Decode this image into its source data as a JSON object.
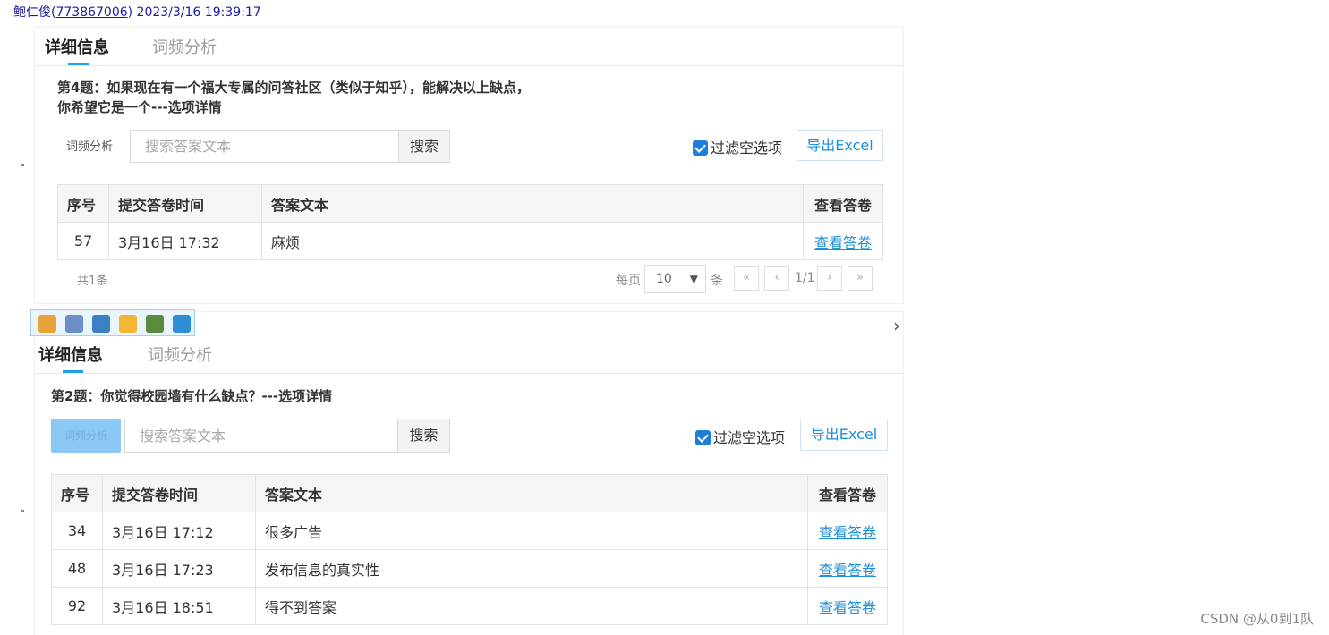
{
  "header": {
    "name": "鲍仁俊(",
    "qq": "773867006",
    "rest": ") 2023/3/16 19:39:17"
  },
  "panel1": {
    "tabs": [
      {
        "label": "详细信息"
      },
      {
        "label": "词频分析"
      }
    ],
    "title_line1": "第4题：如果现在有一个福大专属的问答社区（类似于知乎），能解决以上缺点，",
    "title_line2": "你希望它是一个---选项详情",
    "wordfreq_label": "词频分析",
    "search_placeholder": "搜索答案文本",
    "search_button": "搜索",
    "filter_label": "过滤空选项",
    "export_label": "导出Excel",
    "columns": [
      "序号",
      "提交答卷时间",
      "答案文本",
      "查看答卷"
    ],
    "rows": [
      {
        "num": "57",
        "time": "3月16日 17:32",
        "text": "麻烦",
        "link": "查看答卷"
      }
    ],
    "total": "共1条",
    "per_page_label": "每页",
    "per_page_value": "10",
    "per_page_unit": "条",
    "pager": {
      "first": "«",
      "prev": "‹",
      "page": "1/1",
      "next": "›",
      "last": "»"
    }
  },
  "toolbar": {
    "icons": [
      {
        "name": "add-icon",
        "color": "#e8a23a"
      },
      {
        "name": "save-icon",
        "color": "#6b8fc7"
      },
      {
        "name": "monitor-icon",
        "color": "#3b7fc4"
      },
      {
        "name": "emoji-icon",
        "color": "#f2b632"
      },
      {
        "name": "image-icon",
        "color": "#5a8a3c"
      },
      {
        "name": "star-icon",
        "color": "#2f8fd6"
      }
    ]
  },
  "panel2": {
    "tabs": [
      {
        "label": "详细信息"
      },
      {
        "label": "词频分析"
      }
    ],
    "title_line1": "第2题：你觉得校园墙有什么缺点？---选项详情",
    "wordfreq_label": "词频分析",
    "search_placeholder": "搜索答案文本",
    "search_button": "搜索",
    "filter_label": "过滤空选项",
    "export_label": "导出Excel",
    "columns": [
      "序号",
      "提交答卷时间",
      "答案文本",
      "查看答卷"
    ],
    "rows": [
      {
        "num": "34",
        "time": "3月16日 17:12",
        "text": "很多广告",
        "link": "查看答卷"
      },
      {
        "num": "48",
        "time": "3月16日 17:23",
        "text": "发布信息的真实性",
        "link": "查看答卷"
      },
      {
        "num": "92",
        "time": "3月16日 18:51",
        "text": "得不到答案",
        "link": "查看答卷"
      }
    ]
  },
  "nav": {
    "right_chevron": "›"
  },
  "watermark": "CSDN @从0到1队"
}
